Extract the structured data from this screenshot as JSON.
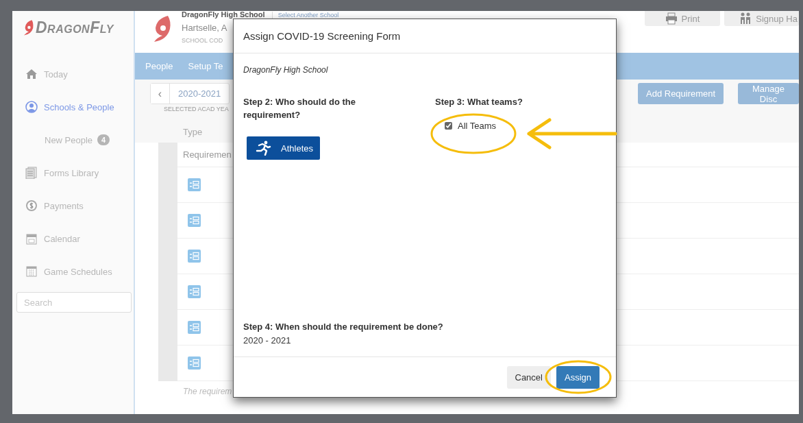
{
  "sidebar": {
    "logo": "DragonFly",
    "items": [
      {
        "label": "Today",
        "selected": false
      },
      {
        "label": "Schools & People",
        "selected": true,
        "children": [
          {
            "label": "New People",
            "badge": "4",
            "selected": false
          }
        ]
      },
      {
        "label": "Forms Library",
        "selected": false
      },
      {
        "label": "Payments",
        "selected": false
      },
      {
        "label": "Calendar",
        "selected": false
      },
      {
        "label": "Game Schedules",
        "selected": false
      }
    ],
    "search": {
      "placeholder": "Search"
    }
  },
  "header": {
    "school": "DragonFly High School",
    "switch_link": "Select Another School",
    "location": "Hartselle, A",
    "code_label": "SCHOOL COD",
    "buttons": [
      "Print",
      "Signup Ha"
    ]
  },
  "nav": {
    "tabs": [
      {
        "label": "People",
        "selected": false
      },
      {
        "label": "Setup Te",
        "selected": false
      }
    ]
  },
  "toolbar": {
    "prev": "‹",
    "year": "2020-2021",
    "year_caption": "SELECTED ACAD YEA",
    "buttons": [
      "Add Requirement",
      "Manage Disc"
    ]
  },
  "table": {
    "columns": [
      "Type"
    ],
    "group_row": "Requiremen",
    "rows": [
      {
        "kind": "form"
      },
      {
        "kind": "form"
      },
      {
        "kind": "form"
      },
      {
        "kind": "form"
      },
      {
        "kind": "form"
      },
      {
        "kind": "form"
      }
    ],
    "footnote": "The requirem"
  },
  "dialog": {
    "title": "Assign COVID-19 Screening Form",
    "school": "DragonFly High School",
    "step2": {
      "heading": "Step 2: Who should do the requirement?",
      "options": [
        {
          "label": "Athletes",
          "selected": true
        }
      ]
    },
    "step3": {
      "heading": "Step 3: What teams?",
      "teams": [
        {
          "label": "All Teams",
          "checked": true
        }
      ]
    },
    "step4": {
      "heading": "Step 4: When should the requirement be done?",
      "value": "2020 - 2021"
    },
    "buttons": [
      {
        "label": "Cancel",
        "kind": "secondary"
      },
      {
        "label": "Assign",
        "kind": "primary"
      }
    ]
  },
  "annotations": [
    {
      "kind": "ellipse"
    },
    {
      "kind": "arrow"
    },
    {
      "kind": "ellipse"
    }
  ]
}
